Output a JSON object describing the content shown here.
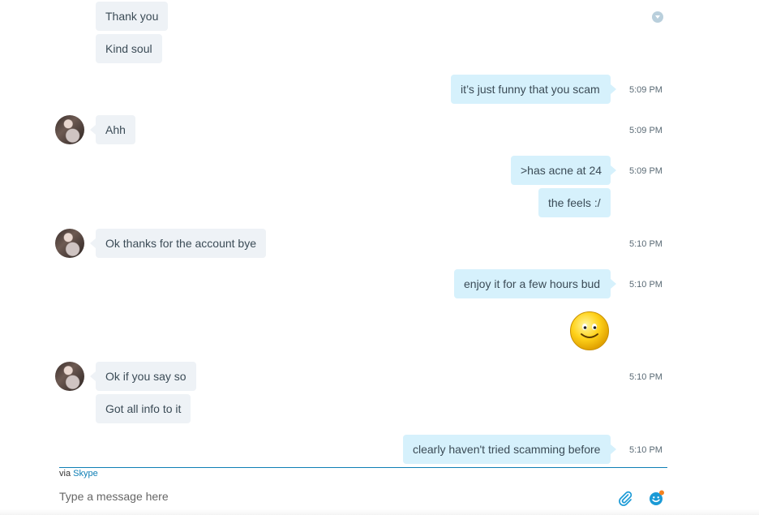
{
  "messages": [
    {
      "text": "Thank you",
      "dir": "in"
    },
    {
      "text": "Kind soul",
      "dir": "in"
    },
    {
      "text": "it’s just funny that you scam",
      "dir": "out",
      "time": "5:09 PM"
    },
    {
      "text": "Ahh",
      "dir": "in",
      "time": "5:09 PM"
    },
    {
      "text": ">has acne at 24",
      "dir": "out",
      "time": "5:09 PM"
    },
    {
      "text": "the feels :/",
      "dir": "out"
    },
    {
      "text": "Ok thanks for the account bye",
      "dir": "in",
      "time": "5:10 PM"
    },
    {
      "text": "enjoy it for a few hours bud",
      "dir": "out",
      "time": "5:10 PM"
    },
    {
      "emoji": "smile-emoticon",
      "dir": "out"
    },
    {
      "text": "Ok if you say so",
      "dir": "in",
      "time": "5:10 PM"
    },
    {
      "text": "Got all info to it",
      "dir": "in"
    },
    {
      "text": "clearly haven't tried scamming before",
      "dir": "out",
      "time": "5:10 PM"
    }
  ],
  "footer": {
    "via_prefix": "via",
    "via_link": "Skype",
    "composer_placeholder": "Type a message here"
  },
  "icons": {
    "attach": "paperclip-icon",
    "emoticons": "emoticon-icon",
    "scroll": "scroll-down-icon"
  },
  "colors": {
    "incoming_bubble": "#eef2f6",
    "outgoing_bubble": "#d6f1fc",
    "accent": "#0f7fb5",
    "notification": "#f58220"
  }
}
